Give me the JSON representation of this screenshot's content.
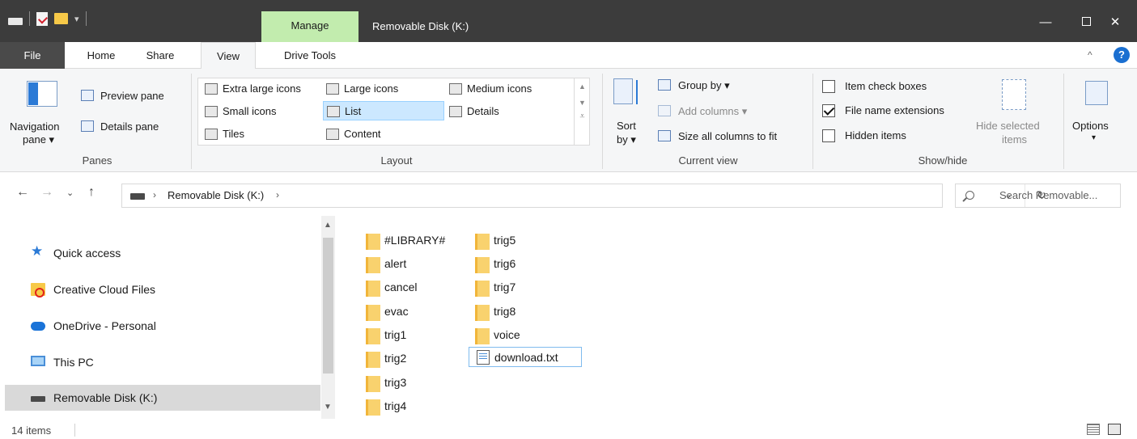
{
  "window": {
    "title": "Removable Disk (K:)",
    "context_tab": "Manage",
    "controls": {
      "minimize": "—",
      "close": "✕"
    }
  },
  "tabs": {
    "file": "File",
    "home": "Home",
    "share": "Share",
    "view": "View",
    "drive_tools": "Drive Tools",
    "help": "?"
  },
  "ribbon": {
    "panes": {
      "navigation_pane": "Navigation",
      "navigation_pane_2": "pane ▾",
      "preview_pane": "Preview pane",
      "details_pane": "Details pane",
      "label": "Panes"
    },
    "layout": {
      "items": [
        "Extra large icons",
        "Large icons",
        "Medium icons",
        "Small icons",
        "List",
        "Details",
        "Tiles",
        "Content"
      ],
      "selected": "List",
      "label": "Layout"
    },
    "current_view": {
      "sort_by_1": "Sort",
      "sort_by_2": "by ▾",
      "group_by": "Group by ▾",
      "add_columns": "Add columns ▾",
      "size_all_columns": "Size all columns to fit",
      "label": "Current view"
    },
    "show_hide": {
      "item_check_boxes": "Item check boxes",
      "file_name_extensions": "File name extensions",
      "hidden_items": "Hidden items",
      "hide_selected_1": "Hide selected",
      "hide_selected_2": "items",
      "label": "Show/hide",
      "item_check_boxes_checked": false,
      "file_name_extensions_checked": true,
      "hidden_items_checked": false
    },
    "options": {
      "label": "Options",
      "arrow": "▾"
    }
  },
  "address": {
    "crumb": "Removable Disk (K:)",
    "search_placeholder": "Search Removable..."
  },
  "navigation": {
    "items": [
      "Quick access",
      "Creative Cloud Files",
      "OneDrive - Personal",
      "This PC",
      "Removable Disk (K:)"
    ],
    "selected": "Removable Disk (K:)"
  },
  "files": {
    "column1": [
      "#LIBRARY#",
      "alert",
      "cancel",
      "evac",
      "trig1",
      "trig2",
      "trig3",
      "trig4"
    ],
    "column2": [
      "trig5",
      "trig6",
      "trig7",
      "trig8",
      "voice",
      "download.txt"
    ],
    "selected": "download.txt"
  },
  "status": {
    "item_count": "14 items"
  }
}
